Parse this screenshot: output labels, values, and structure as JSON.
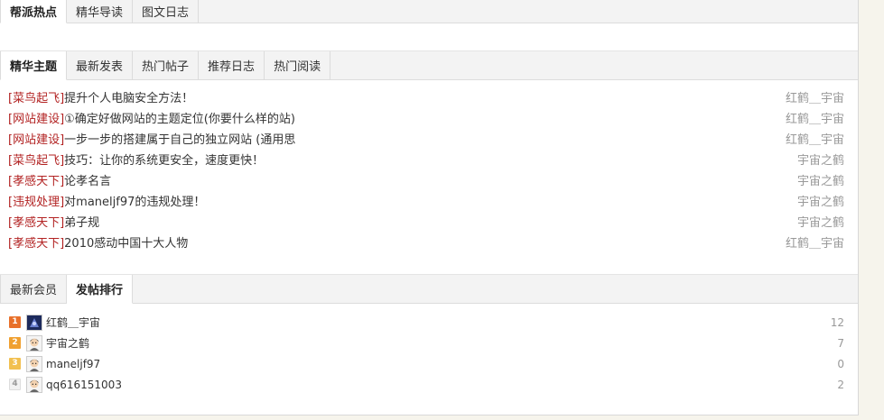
{
  "top_tabs": [
    {
      "label": "帮派热点",
      "active": true
    },
    {
      "label": "精华导读",
      "active": false
    },
    {
      "label": "图文日志",
      "active": false
    }
  ],
  "thread_tabs": [
    {
      "label": "精华主题",
      "active": true
    },
    {
      "label": "最新发表",
      "active": false
    },
    {
      "label": "热门帖子",
      "active": false
    },
    {
      "label": "推荐日志",
      "active": false
    },
    {
      "label": "热门阅读",
      "active": false
    }
  ],
  "threads": [
    {
      "category": "[菜鸟起飞]",
      "title": "提升个人电脑安全方法！",
      "author": "红鹤＿宇宙"
    },
    {
      "category": "[网站建设]",
      "title": "①确定好做网站的主题定位(你要什么样的站)",
      "author": "红鹤＿宇宙"
    },
    {
      "category": "[网站建设]",
      "title": "一步一步的搭建属于自己的独立网站 (通用思",
      "author": "红鹤＿宇宙"
    },
    {
      "category": "[菜鸟起飞]",
      "title": "技巧：让你的系统更安全，速度更快！",
      "author": "宇宙之鹤"
    },
    {
      "category": "[孝感天下]",
      "title": "论孝名言",
      "author": "宇宙之鹤"
    },
    {
      "category": "[违规处理]",
      "title": "对maneljf97的违规处理！",
      "author": "宇宙之鹤"
    },
    {
      "category": "[孝感天下]",
      "title": "弟子规",
      "author": "宇宙之鹤"
    },
    {
      "category": "[孝感天下]",
      "title": "2010感动中国十大人物",
      "author": "红鹤＿宇宙"
    }
  ],
  "member_tabs": [
    {
      "label": "最新会员",
      "active": false
    },
    {
      "label": "发帖排行",
      "active": true
    }
  ],
  "ranking": [
    {
      "rank": "1",
      "name": "红鹤＿宇宙",
      "count": "12",
      "badge_color": "#e8702a",
      "avatar": "avatar-dark-icon"
    },
    {
      "rank": "2",
      "name": "宇宙之鹤",
      "count": "7",
      "badge_color": "#f0a030",
      "avatar": "avatar-face-icon"
    },
    {
      "rank": "3",
      "name": "maneljf97",
      "count": "0",
      "badge_color": "#f2c050",
      "avatar": "avatar-face-icon"
    },
    {
      "rank": "4",
      "name": "qq616151003",
      "count": "2",
      "badge_color": "#f2f2f2",
      "avatar": "avatar-face-icon"
    }
  ],
  "colors": {
    "category": "#b22222",
    "meta": "#999999",
    "background": "#f6f4ec"
  }
}
